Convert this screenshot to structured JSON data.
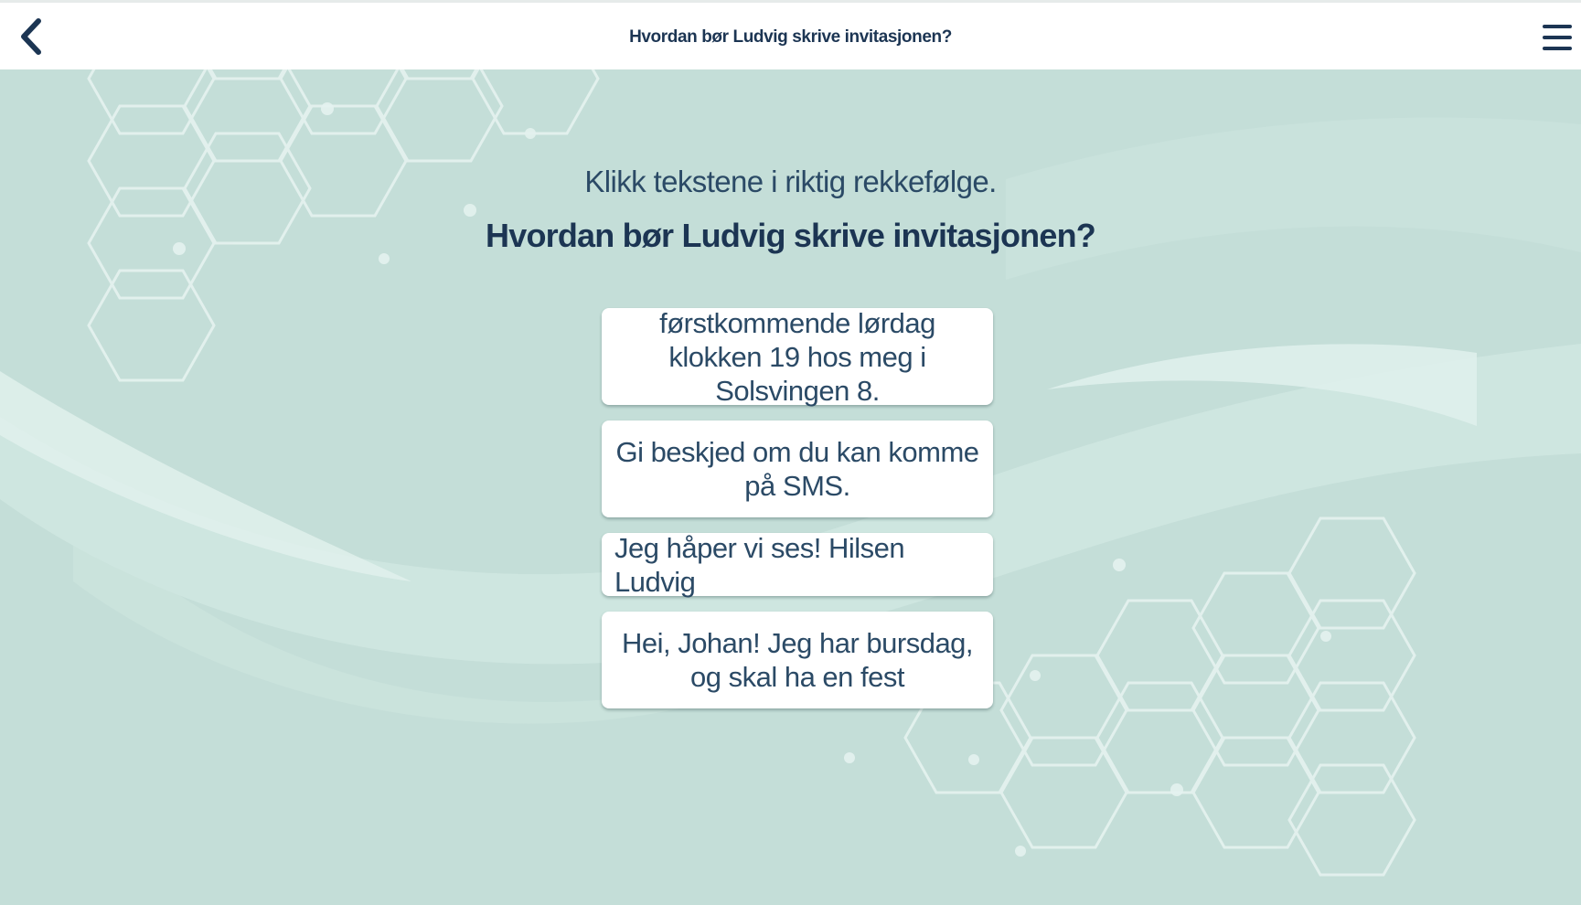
{
  "header": {
    "title": "Hvordan bør Ludvig skrive invitasjonen?"
  },
  "task": {
    "instruction": "Klikk tekstene i riktig rekkefølge.",
    "question": "Hvordan bør Ludvig skrive invitasjonen?"
  },
  "options": [
    {
      "text": "førstkommende lørdag klokken 19 hos meg i Solsvingen 8."
    },
    {
      "text": "Gi beskjed om du kan komme på SMS."
    },
    {
      "text": "Jeg håper vi ses! Hilsen Ludvig"
    },
    {
      "text": "Hei, Johan! Jeg har bursdag, og skal ha en fest"
    }
  ],
  "colors": {
    "background": "#c4ded8",
    "header_bg": "#ffffff",
    "text_dark": "#1c3553",
    "text": "#2b4a66",
    "card_bg": "#ffffff"
  },
  "icons": {
    "back": "chevron-left-icon",
    "menu": "hamburger-menu-icon"
  }
}
